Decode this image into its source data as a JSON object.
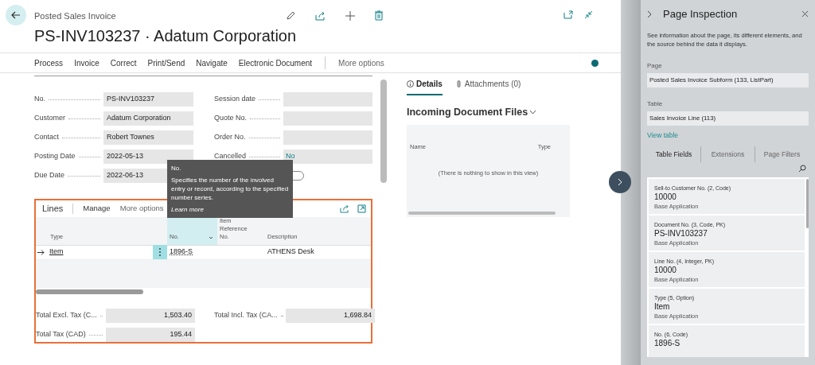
{
  "header": {
    "breadcrumb": "Posted Sales Invoice",
    "title": "PS-INV103237 · Adatum Corporation"
  },
  "action_bar": {
    "items": [
      "Process",
      "Invoice",
      "Correct",
      "Print/Send",
      "Navigate",
      "Electronic Document"
    ],
    "more": "More options"
  },
  "general": {
    "left": [
      {
        "label": "No.",
        "value": "PS-INV103237"
      },
      {
        "label": "Customer",
        "value": "Adatum Corporation"
      },
      {
        "label": "Contact",
        "value": "Robert Townes"
      },
      {
        "label": "Posting Date",
        "value": "2022-05-13"
      },
      {
        "label": "Due Date",
        "value": "2022-06-13"
      }
    ],
    "right": [
      {
        "kind": "text",
        "label": "Session date"
      },
      {
        "kind": "text",
        "label": "Quote No."
      },
      {
        "kind": "text",
        "label": "Order No."
      },
      {
        "kind": "link",
        "label": "Cancelled",
        "value": "No"
      },
      {
        "kind": "toggle",
        "on": false
      }
    ]
  },
  "tooltip": {
    "title": "No.",
    "text": "Specifies the number of the involved entry or record, according to the specified number series.",
    "link": "Learn more"
  },
  "lines": {
    "title": "Lines",
    "actions": [
      "Manage",
      "More options"
    ],
    "columns": [
      {
        "label": "Type",
        "selected": false
      },
      {
        "label": "No.",
        "selected": true
      },
      {
        "label": "Item Reference No.",
        "selected": false
      },
      {
        "label": "Description",
        "selected": false
      }
    ],
    "rows": [
      {
        "type": "Item",
        "no": "1896-S",
        "item_reference_no": "",
        "description": "ATHENS Desk"
      }
    ],
    "totals": [
      {
        "label": "Total Excl. Tax (C...",
        "value": "1,503.40"
      },
      {
        "label": "Total Incl. Tax (CA...",
        "value": "1,698.84"
      },
      {
        "label": "Total Tax (CAD)",
        "value": "195.44"
      }
    ]
  },
  "factbox": {
    "tabs": [
      {
        "label": "Details",
        "selected": true
      },
      {
        "label": "Attachments (0)",
        "selected": false
      }
    ],
    "section_title": "Incoming Document Files",
    "columns": [
      "Name",
      "Type"
    ],
    "empty_text": "(There is nothing to show in this view)"
  },
  "inspection": {
    "title": "Page Inspection",
    "description": "See information about the page, its different elements, and the source behind the data it displays.",
    "page_label": "Page",
    "page_value": "Posted Sales Invoice Subform (133, ListPart)",
    "table_label": "Table",
    "table_value": "Sales Invoice Line (113)",
    "link": "View table",
    "tabs": [
      {
        "label": "Table Fields",
        "selected": true
      },
      {
        "label": "Extensions",
        "selected": false
      },
      {
        "label": "Page Filters",
        "selected": false
      }
    ],
    "fields": [
      {
        "caption": "Sell-to Customer No. (2, Code)",
        "value": "10000",
        "source": "Base Application"
      },
      {
        "caption": "Document No. (3, Code, PK)",
        "value": "PS-INV103237",
        "source": "Base Application"
      },
      {
        "caption": "Line No. (4, Integer, PK)",
        "value": "10000",
        "source": "Base Application"
      },
      {
        "caption": "Type (5, Option)",
        "value": "Item",
        "source": "Base Application"
      },
      {
        "caption": "No. (6, Code)",
        "value": "1896-S"
      }
    ]
  }
}
